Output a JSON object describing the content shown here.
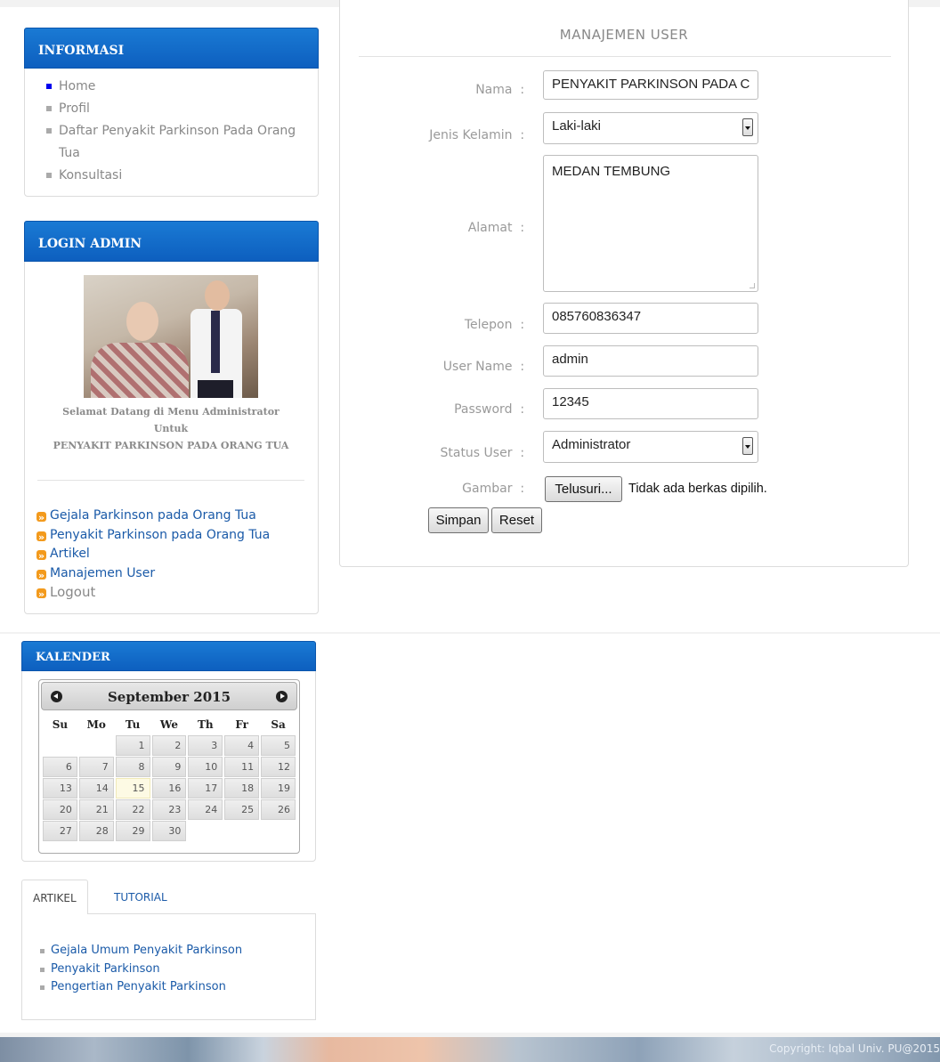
{
  "sidebar": {
    "informasi": {
      "title": "INFORMASI",
      "items": [
        {
          "label": "Home"
        },
        {
          "label": "Profil"
        },
        {
          "label": "Daftar Penyakit Parkinson Pada Orang"
        },
        {
          "label": "Tua"
        },
        {
          "label": "Konsultasi"
        }
      ]
    },
    "login_admin": {
      "title": "LOGIN ADMIN",
      "welcome_line1": "Selamat Datang di Menu Administrator",
      "welcome_line2": "Untuk",
      "welcome_line3": "PENYAKIT PARKINSON PADA ORANG TUA",
      "links": [
        {
          "label": "Gejala Parkinson pada Orang Tua"
        },
        {
          "label": "Penyakit Parkinson pada Orang Tua"
        },
        {
          "label": "Artikel"
        },
        {
          "label": "Manajemen User"
        },
        {
          "label": "Logout"
        }
      ]
    },
    "kalender": {
      "title": "KALENDER",
      "month": "September 2015",
      "weekdays": [
        "Su",
        "Mo",
        "Tu",
        "We",
        "Th",
        "Fr",
        "Sa"
      ],
      "weeks": [
        [
          "",
          "",
          "1",
          "2",
          "3",
          "4",
          "5"
        ],
        [
          "6",
          "7",
          "8",
          "9",
          "10",
          "11",
          "12"
        ],
        [
          "13",
          "14",
          "15",
          "16",
          "17",
          "18",
          "19"
        ],
        [
          "20",
          "21",
          "22",
          "23",
          "24",
          "25",
          "26"
        ],
        [
          "27",
          "28",
          "29",
          "30",
          "",
          "",
          ""
        ]
      ],
      "today": "15"
    },
    "tabs": {
      "labels": [
        "ARTIKEL",
        "TUTORIAL"
      ],
      "items": [
        {
          "label": "Gejala Umum Penyakit Parkinson"
        },
        {
          "label": "Penyakit Parkinson"
        },
        {
          "label": "Pengertian Penyakit Parkinson"
        }
      ]
    }
  },
  "form": {
    "title": "MANAJEMEN USER",
    "fields": {
      "nama": {
        "label": "Nama",
        "value": "PENYAKIT PARKINSON PADA C"
      },
      "jenis_kelamin": {
        "label": "Jenis Kelamin",
        "value": "Laki-laki"
      },
      "alamat": {
        "label": "Alamat",
        "value": "MEDAN TEMBUNG"
      },
      "telepon": {
        "label": "Telepon",
        "value": "085760836347"
      },
      "username": {
        "label": "User Name",
        "value": "admin"
      },
      "password": {
        "label": "Password",
        "value": "12345"
      },
      "status": {
        "label": "Status User",
        "value": "Administrator"
      },
      "gambar": {
        "label": "Gambar",
        "browse_label": "Telusuri...",
        "no_file": "Tidak ada berkas dipilih."
      }
    },
    "separator": ":",
    "buttons": {
      "save": "Simpan",
      "reset": "Reset"
    }
  },
  "footer": {
    "copyright": "Copyright: Iqbal Univ. PU@2015"
  },
  "colors": {
    "header_blue": "#0d5fbf",
    "link_blue": "#1a5aa8",
    "bullet_orange": "#f39a1c"
  }
}
